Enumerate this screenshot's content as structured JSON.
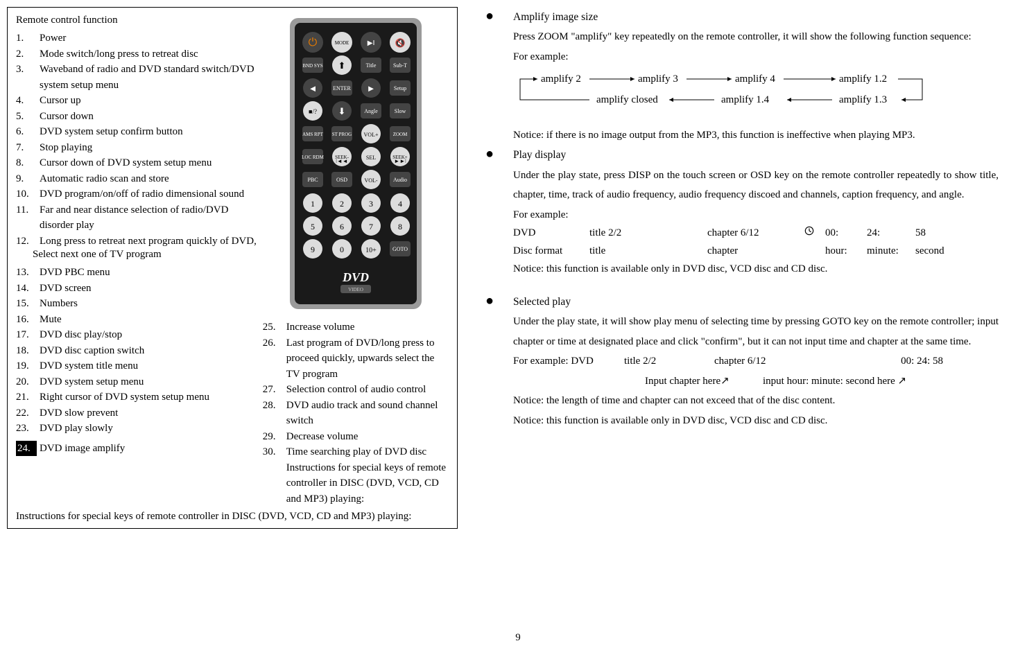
{
  "left": {
    "title": "Remote control function",
    "items_a": [
      {
        "n": "1.",
        "t": "Power"
      },
      {
        "n": "2.",
        "t": "Mode switch/long press to retreat disc"
      },
      {
        "n": "3.",
        "t": "Waveband of radio and DVD standard switch/DVD system setup menu"
      },
      {
        "n": "4.",
        "t": "Cursor up"
      },
      {
        "n": "5.",
        "t": "Cursor down"
      },
      {
        "n": "6.",
        "t": "DVD system setup confirm button"
      },
      {
        "n": "7.",
        "t": "Stop playing"
      },
      {
        "n": "8.",
        "t": "Cursor down of DVD system setup menu"
      },
      {
        "n": "9.",
        "t": "Automatic radio scan and store"
      },
      {
        "n": "10.",
        "t": "DVD program/on/off of radio dimensional sound"
      },
      {
        "n": "11.",
        "t": "Far and near distance selection of radio/DVD disorder play"
      },
      {
        "n": "12.",
        "t": "Long press to retreat next program quickly of DVD,"
      }
    ],
    "item12_sub": "Select next one of TV program",
    "items_b": [
      {
        "n": "13.",
        "t": "DVD PBC menu"
      },
      {
        "n": "14.",
        "t": "DVD screen"
      },
      {
        "n": "15.",
        "t": "Numbers"
      },
      {
        "n": "16.",
        "t": "Mute"
      },
      {
        "n": "17.",
        "t": "DVD disc play/stop"
      },
      {
        "n": "18.",
        "t": "DVD disc caption switch"
      },
      {
        "n": "19.",
        "t": "DVD system title menu"
      },
      {
        "n": "20.",
        "t": "DVD system setup menu"
      },
      {
        "n": "21.",
        "t": "Right cursor of DVD system setup menu"
      },
      {
        "n": "22.",
        "t": "DVD slow prevent"
      },
      {
        "n": "23.",
        "t": "DVD play slowly"
      }
    ],
    "item24_n": "24.",
    "item24_t": "DVD image amplify",
    "items_c": [
      {
        "n": "25.",
        "t": "Increase volume"
      },
      {
        "n": "26.",
        "t": "Last program of DVD/long press to proceed quickly, upwards select the TV program"
      },
      {
        "n": "27.",
        "t": "Selection control of audio control"
      },
      {
        "n": "28.",
        "t": "DVD audio track and sound channel switch"
      },
      {
        "n": "29.",
        "t": "Decrease volume"
      },
      {
        "n": "30.",
        "t": "Time searching play of DVD disc Instructions for special keys of remote controller in DISC (DVD, VCD, CD and MP3) playing:"
      }
    ],
    "footer": "Instructions for special keys of remote controller in DISC (DVD, VCD, CD and MP3) playing:"
  },
  "remote_labels": {
    "r1": [
      "MODE",
      "",
      ""
    ],
    "r2": [
      "BND SYS",
      "",
      "Title",
      "Sub-T"
    ],
    "r3": [
      "",
      "ENTER",
      "",
      "Setup"
    ],
    "r4": [
      "",
      "",
      "Angle",
      "Slow"
    ],
    "r5": [
      "AMS RPT",
      "ST PROG",
      "VOL+",
      "ZOOM"
    ],
    "r6": [
      "LOC RDM",
      "SEEK-",
      "SEL",
      "SEEK+"
    ],
    "r7": [
      "PBC",
      "OSD",
      "VOL-",
      "Audio"
    ],
    "nums": [
      "1",
      "2",
      "3",
      "4",
      "5",
      "6",
      "7",
      "8",
      "9",
      "0",
      "10+",
      "GOTO"
    ],
    "dvd": "DVD",
    "video": "VIDEO"
  },
  "right": {
    "amplify": {
      "title": "Amplify image size",
      "p1": "Press ZOOM \"amplify\" key repeatedly on the remote controller, it will show the following function sequence:",
      "p2": "For example:",
      "flow": [
        "amplify 2",
        "amplify 3",
        "amplify 4",
        "amplify 1.2",
        "amplify closed",
        "amplify 1.4",
        "amplify 1.3"
      ],
      "p3": "Notice: if there is no image output from the MP3, this function is ineffective when playing MP3."
    },
    "play": {
      "title": "Play display",
      "p1": "Under the play state, press DISP on the touch screen or OSD key on the remote controller repeatedly to show title, chapter, time, track of audio frequency, audio frequency discoed and channels, caption frequency, and angle.",
      "p2": "For example:",
      "row1": [
        "DVD",
        "title 2/2",
        "chapter 6/12",
        "",
        "00:",
        "24:",
        "58"
      ],
      "row2": [
        "Disc format",
        "title",
        "chapter",
        "",
        "hour:",
        "minute:",
        "second"
      ],
      "p3": "Notice: this function is available only in DVD disc, VCD disc and CD disc."
    },
    "selected": {
      "title": "Selected play",
      "p1": "Under the play state, it will show play menu of selecting time by pressing GOTO key on the remote controller; input chapter or time at designated place and click \"confirm\", but it can not input time and chapter at the same time.",
      "r1": [
        "For example: DVD",
        "title 2/2",
        "chapter 6/12",
        "00: 24: 58"
      ],
      "r2": [
        "",
        "Input chapter here↗",
        "input hour: minute: second here ↗"
      ],
      "p2": "Notice: the length of time and chapter can not exceed that of the disc content.",
      "p3": "Notice: this function is available only in DVD disc, VCD disc and CD disc."
    }
  },
  "page_number": "9"
}
